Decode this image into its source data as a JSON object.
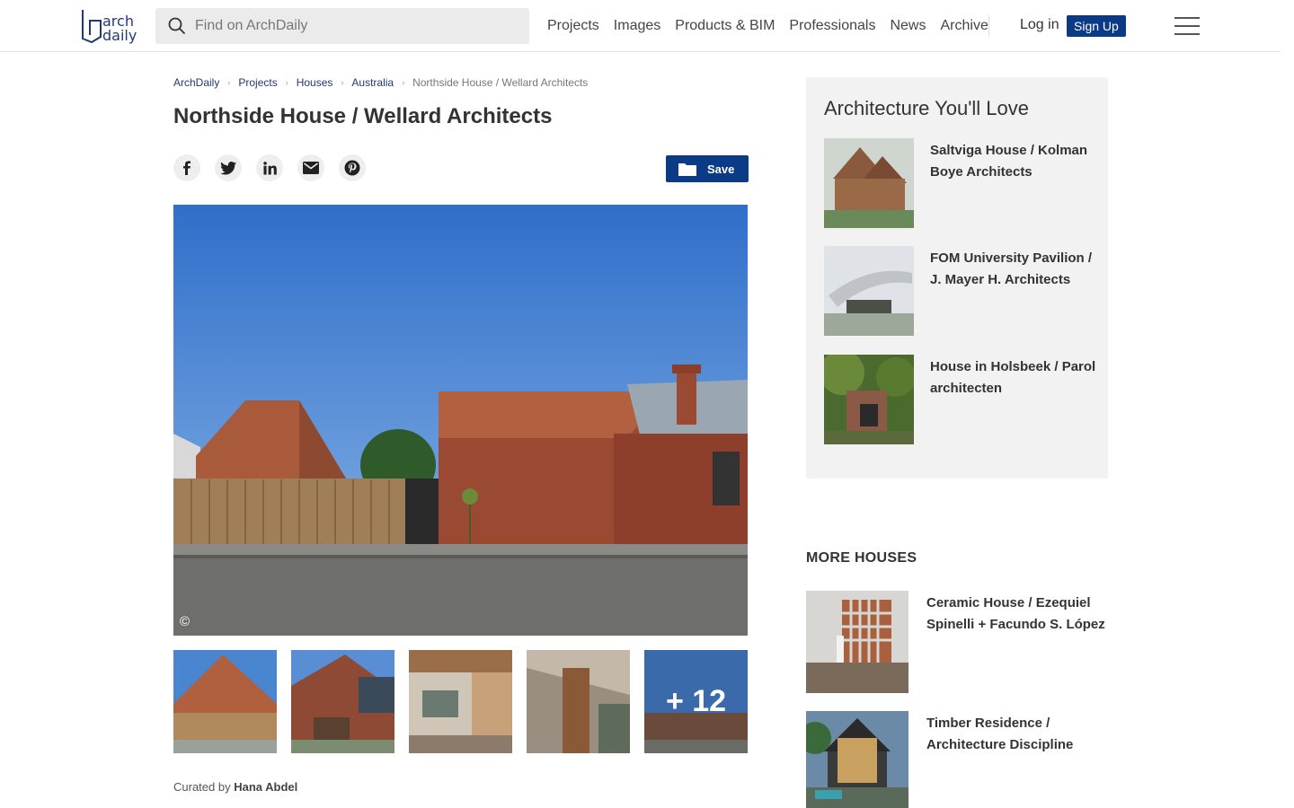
{
  "header": {
    "logo_line1": "arch",
    "logo_line2": "daily",
    "search_placeholder": "Find on ArchDaily",
    "nav": [
      "Projects",
      "Images",
      "Products & BIM",
      "Professionals",
      "News",
      "Archive"
    ],
    "login": "Log in",
    "signup": "Sign Up"
  },
  "breadcrumb": [
    "ArchDaily",
    "Projects",
    "Houses",
    "Australia"
  ],
  "breadcrumb_current": "Northside House / Wellard Architects",
  "title": "Northside House / Wellard Architects",
  "save_label": "Save",
  "hero": {
    "copyright_symbol": "©"
  },
  "gallery": {
    "more_label": "+ 12"
  },
  "curated_prefix": "Curated by",
  "curated_name": "Hana Abdel",
  "sidebar": {
    "love_title": "Architecture You'll Love",
    "love_items": [
      "Saltviga House / Kolman Boye Architects",
      "FOM University Pavilion / J. Mayer H. Architects",
      "House in Holsbeek / Parol architecten"
    ],
    "more_title": "MORE HOUSES",
    "more_items": [
      "Ceramic House / Ezequiel Spinelli + Facundo S. López",
      "Timber Residence / Architecture Discipline"
    ]
  },
  "colors": {
    "brand": "#0b3a87",
    "link": "#1f3a78",
    "panel": "#f2f2f2"
  },
  "icons": [
    "search-icon",
    "facebook-icon",
    "twitter-icon",
    "linkedin-icon",
    "email-icon",
    "pinterest-icon",
    "folder-icon",
    "menu-icon"
  ]
}
